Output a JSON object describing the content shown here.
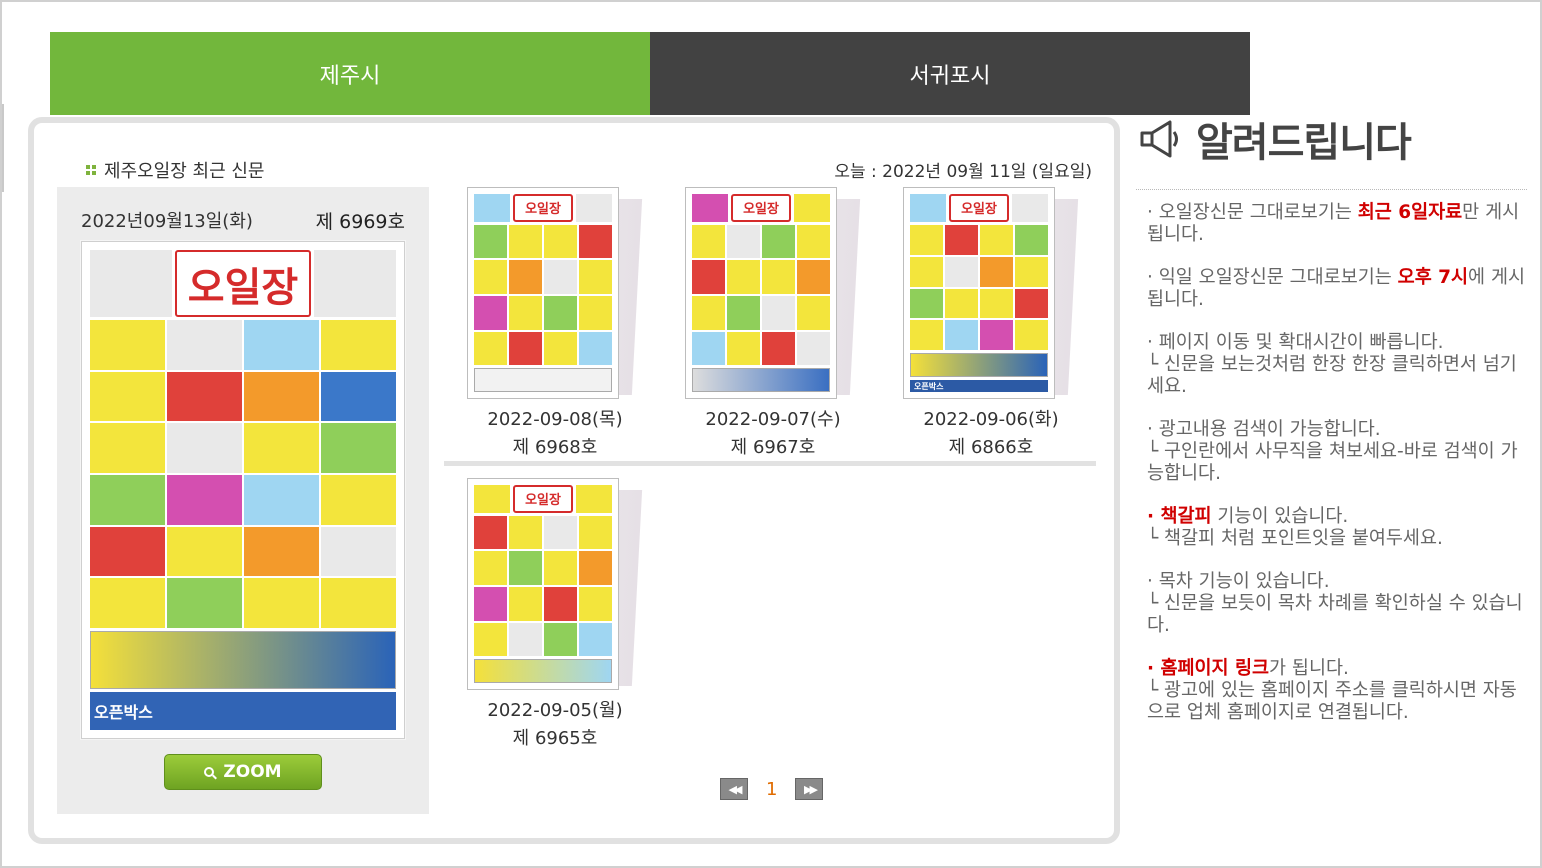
{
  "tabs": [
    {
      "label": "제주시",
      "active": true
    },
    {
      "label": "서귀포시",
      "active": false
    }
  ],
  "panel": {
    "title": "제주오일장 최근 신문",
    "today": "오늘 : 2022년 09월 11일 (일요일)"
  },
  "featured": {
    "date": "2022년09월13일(화)",
    "issue": "제 6969호",
    "zoom_label": "ZOOM"
  },
  "newspaper": {
    "logo": "오일장",
    "footer": "오픈박스"
  },
  "thumbnails": [
    {
      "date": "2022-09-08(목)",
      "issue": "제 6968호"
    },
    {
      "date": "2022-09-07(수)",
      "issue": "제 6967호"
    },
    {
      "date": "2022-09-06(화)",
      "issue": "제 6866호"
    },
    {
      "date": "2022-09-05(월)",
      "issue": "제 6965호"
    }
  ],
  "pagination": {
    "prev": "◀◀",
    "current": "1",
    "next": "▶▶"
  },
  "notice": {
    "title": "알려드립니다",
    "icon": "megaphone-icon",
    "p1_a": "· 오일장신문 그대로보기는 ",
    "p1_hl": "최근 6일자료",
    "p1_b": "만 게시됩니다.",
    "p2_a": "· 익일 오일장신문 그대로보기는 ",
    "p2_hl": "오후 7시",
    "p2_b": "에 게시됩니다.",
    "p3_a": "· 페이지 이동 및 확대시간이 빠릅니다.",
    "p3_b": " └ 신문을 보는것처럼 한장 한장 클릭하면서 넘기세요.",
    "p4_a": "· 광고내용 검색이 가능합니다.",
    "p4_b": " └ 구인란에서 사무직을 쳐보세요-바로 검색이 가능합니다.",
    "p5_hl": "· 책갈피",
    "p5_a": " 기능이 있습니다.",
    "p5_b": " └ 책갈피 처럼 포인트잇을 붙여두세요.",
    "p6_a": "· 목차 기능이 있습니다.",
    "p6_b": " └ 신문을 보듯이 목차 차례를 확인하실 수 있습니다.",
    "p7_hl": "· 홈페이지 링크",
    "p7_a": "가 됩니다.",
    "p7_b": " └ 광고에 있는 홈페이지 주소를 클릭하시면 자동으로 업체 홈페이지로 연결됩니다."
  },
  "colors": {
    "tab_active": "#72b73c",
    "tab_inactive": "#424242",
    "highlight": "#d00000",
    "page_number": "#e06c00"
  }
}
